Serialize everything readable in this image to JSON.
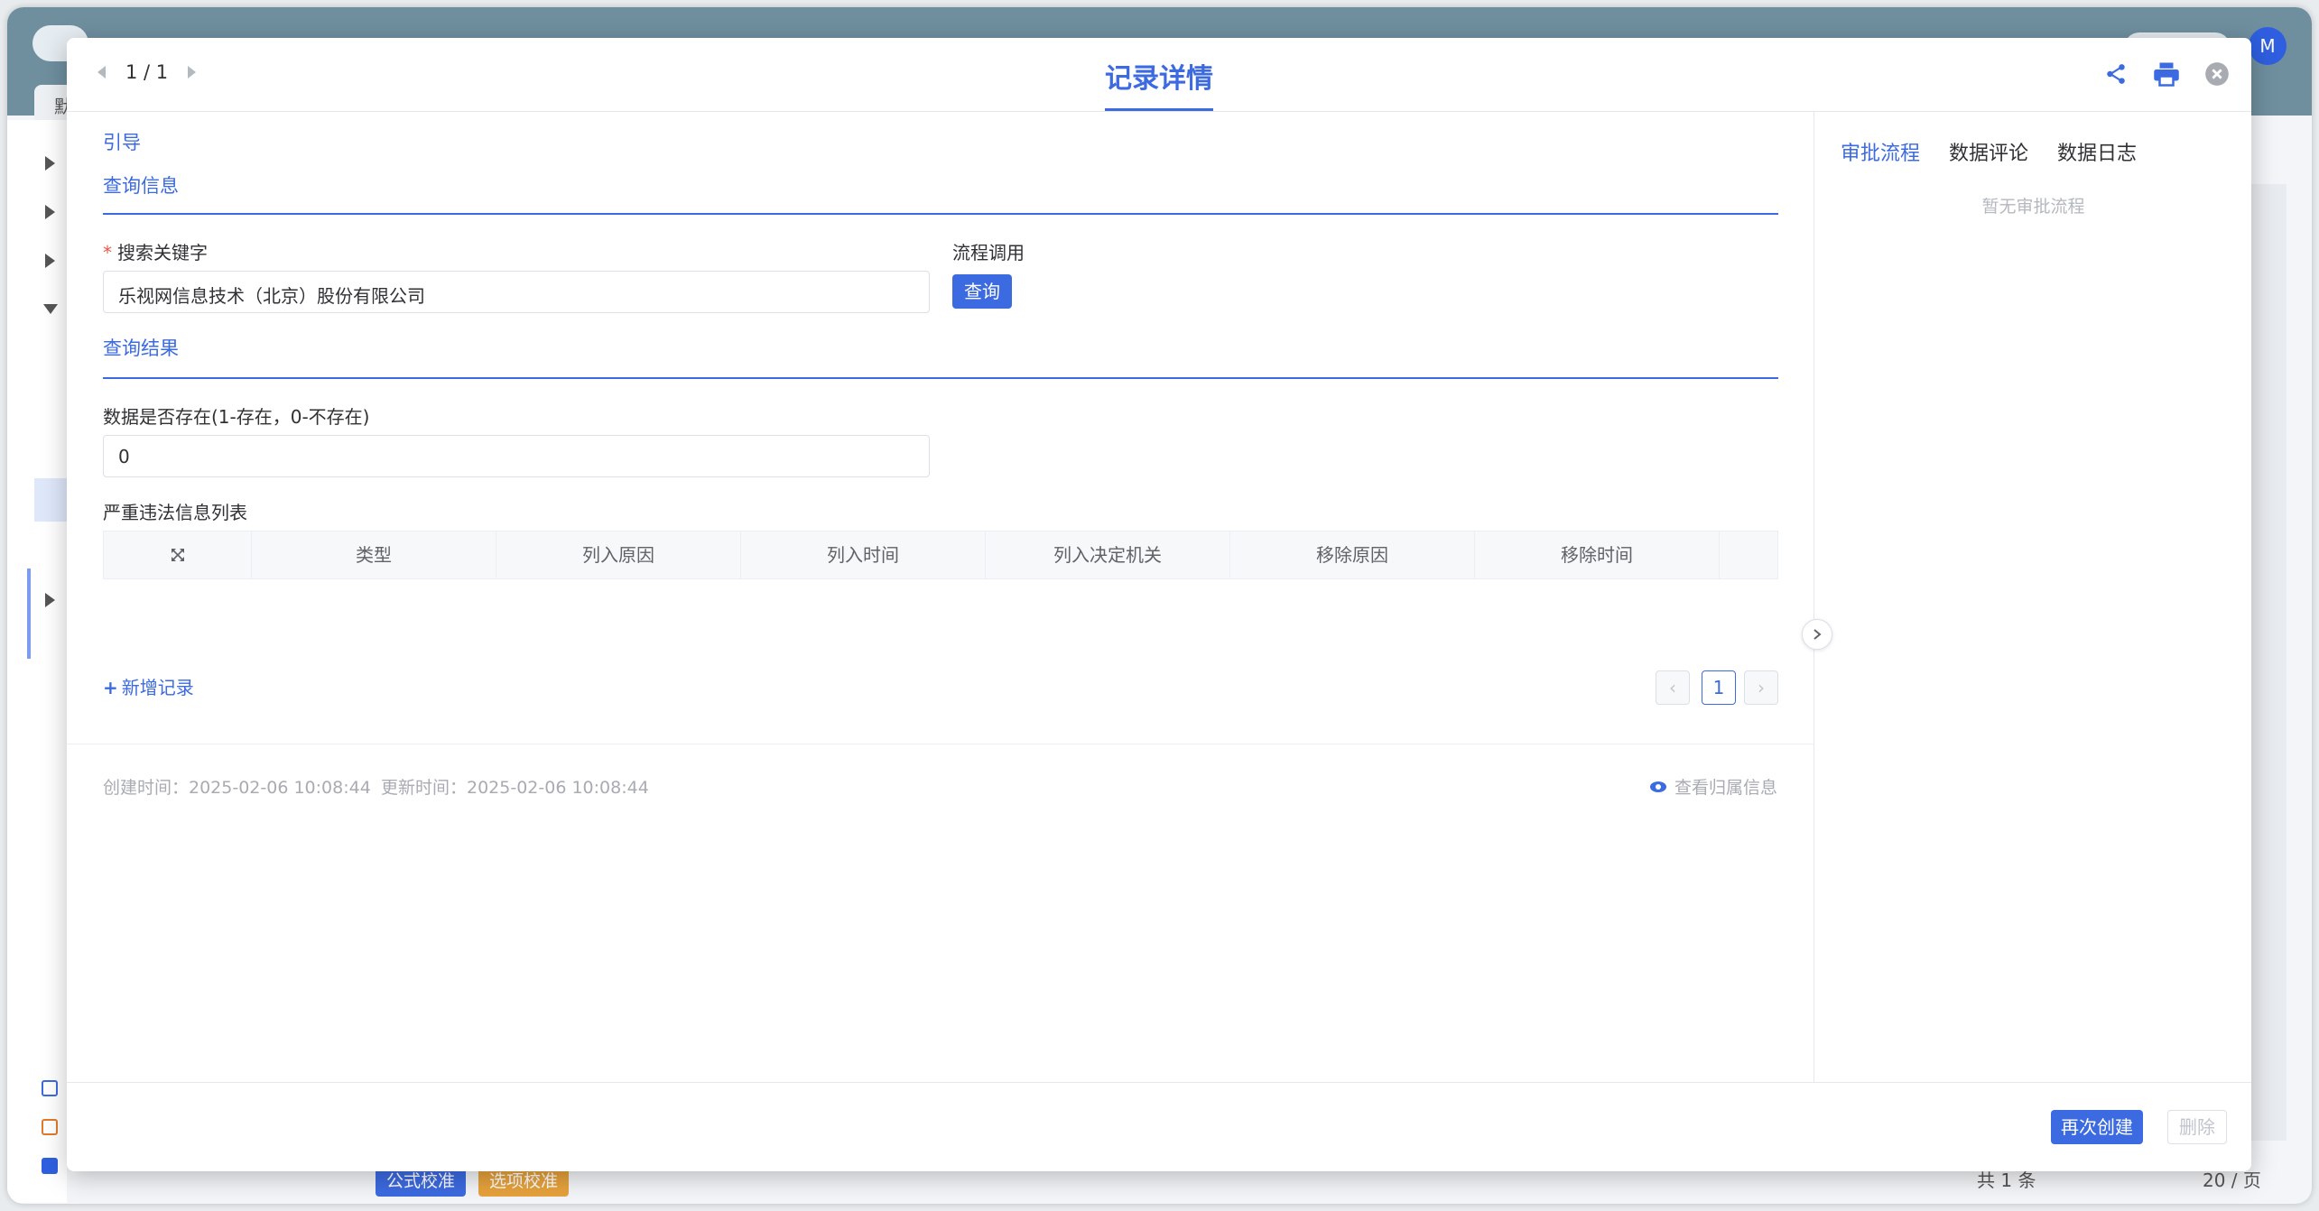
{
  "background": {
    "tab_label": "默",
    "avatar_initial": "M",
    "footer_btn_formula": "公式校准",
    "footer_btn_option": "选项校准",
    "footer_total": "共 1 条",
    "footer_page_size": "20 / 页"
  },
  "modal": {
    "title": "记录详情",
    "pager_text": "1 / 1",
    "icons": [
      "share-icon",
      "print-icon",
      "close-icon"
    ]
  },
  "form": {
    "section_guide": "引导",
    "section_query_info": "查询信息",
    "keyword_label": "搜索关键字",
    "keyword_value": "乐视网信息技术（北京）股份有限公司",
    "flow_label": "流程调用",
    "query_button": "查询",
    "section_query_result": "查询结果",
    "exists_label": "数据是否存在(1-存在，0-不存在)",
    "exists_value": "0",
    "violation_list_label": "严重违法信息列表",
    "table_headers": [
      "类型",
      "列入原因",
      "列入时间",
      "列入决定机关",
      "移除原因",
      "移除时间"
    ],
    "add_record": "新增记录",
    "page_current": "1"
  },
  "meta": {
    "created": "创建时间：2025-02-06 10:08:44",
    "updated": "更新时间：2025-02-06 10:08:44",
    "view_owner": "查看归属信息"
  },
  "side": {
    "tabs": [
      "审批流程",
      "数据评论",
      "数据日志"
    ],
    "empty_hint": "暂无审批流程"
  },
  "footer": {
    "recreate": "再次创建",
    "delete": "删除"
  },
  "colors": {
    "accent": "#3c6ae0",
    "required": "#e8594a"
  }
}
